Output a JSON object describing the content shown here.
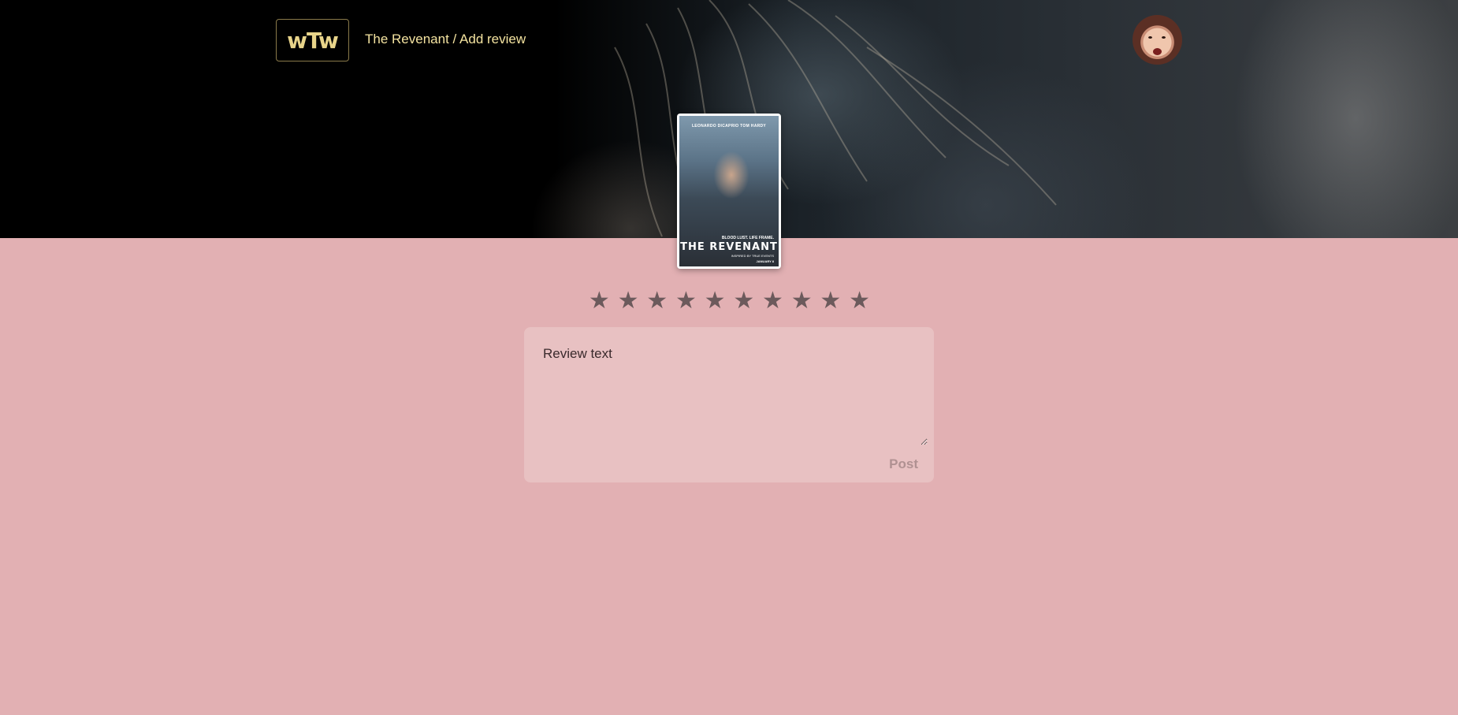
{
  "header": {
    "logo_text": "wTw",
    "breadcrumb": "The Revenant / Add review",
    "avatar_icon": "user-avatar"
  },
  "movie": {
    "poster": {
      "credits": "LEONARDO DICAPRIO   TOM HARDY",
      "tagline": "BLOOD LUST. LIFE FRAME.",
      "title": "THE REVENANT",
      "subtitle": "INSPIRED BY TRUE EVENTS",
      "release": "JANUARY 8"
    }
  },
  "rating": {
    "max": 10,
    "selected": 0,
    "stars": [
      "★",
      "★",
      "★",
      "★",
      "★",
      "★",
      "★",
      "★",
      "★",
      "★"
    ]
  },
  "review": {
    "placeholder": "Review text",
    "post_label": "Post"
  },
  "colors": {
    "page_bg": "#e2b0b3",
    "card_bg": "#e8c1c2",
    "star_color": "#6c5a5c",
    "header_text": "#f4e3a0",
    "post_disabled": "#b09192"
  }
}
